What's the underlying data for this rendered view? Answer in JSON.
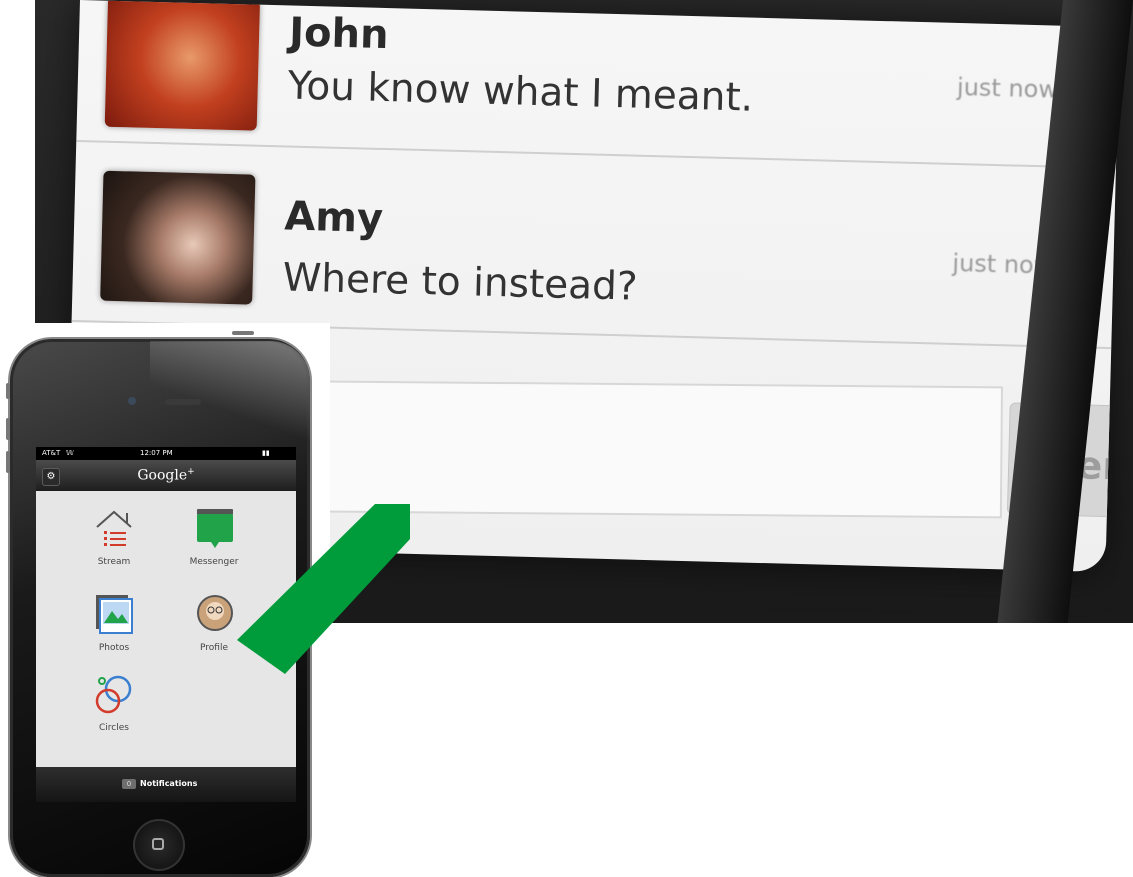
{
  "messenger": {
    "messages": [
      {
        "sender": "John",
        "text": "You know what I meant.",
        "time": "just now"
      },
      {
        "sender": "Amy",
        "text": "Where to instead?",
        "time": "just now"
      }
    ],
    "compose_placeholder": "",
    "send_label": "Send"
  },
  "phone": {
    "status": {
      "carrier": "AT&T",
      "time": "12:07 PM"
    },
    "app_title": "Google",
    "app_title_suffix": "+",
    "tiles": [
      {
        "label": "Stream",
        "icon": "stream-icon"
      },
      {
        "label": "Messenger",
        "icon": "messenger-icon"
      },
      {
        "label": "Photos",
        "icon": "photos-icon"
      },
      {
        "label": "Profile",
        "icon": "profile-icon"
      },
      {
        "label": "Circles",
        "icon": "circles-icon"
      }
    ],
    "notifications": {
      "count": "0",
      "label": "Notifications"
    }
  },
  "colors": {
    "arrow": "#009b3a",
    "stream": "#d23b2b",
    "messenger": "#21a34a",
    "photos": "#3a7fd0"
  }
}
